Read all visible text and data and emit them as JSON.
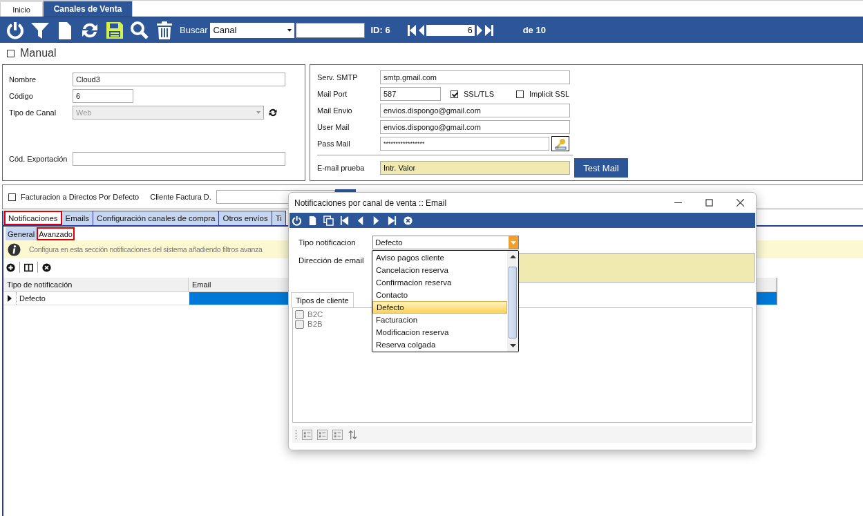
{
  "app_tabs": [
    {
      "label": "Inicio",
      "selected": false
    },
    {
      "label": "Canales de Venta",
      "selected": true
    }
  ],
  "toolbar": {
    "search_label": "Buscar",
    "search_by": "Canal",
    "id_label": "ID: 6",
    "record": "6",
    "record_total": "de 10"
  },
  "manual": {
    "label": "Manual",
    "checked": false
  },
  "general_fields": [
    {
      "kind": "text",
      "label": "Nombre",
      "value": "Cloud3"
    },
    {
      "kind": "short",
      "label": "Código",
      "value": "6"
    },
    {
      "kind": "select",
      "label": "Tipo de Canal",
      "value": "Web",
      "disabled": true
    },
    {
      "kind": "text",
      "label": "Cód. Exportación"
    }
  ],
  "mail_fields": [
    {
      "kind": "text",
      "label": "Serv. SMTP",
      "value": "smtp.gmail.com"
    },
    {
      "kind": "port",
      "label": "Mail Port",
      "value": "587",
      "options": [
        {
          "label": "SSL/TLS",
          "checked": true
        },
        {
          "label": "Implicit SSL",
          "checked": false
        }
      ]
    },
    {
      "kind": "text",
      "label": "Mail Envio",
      "value": "envios.dispongo@gmail.com"
    },
    {
      "kind": "text",
      "label": "User Mail",
      "value": "envios.dispongo@gmail.com"
    },
    {
      "kind": "password",
      "label": "Pass Mail",
      "value": "*****************"
    },
    {
      "kind": "test",
      "label": "E-mail prueba",
      "value": "Intr. Valor",
      "button": "Test Mail"
    }
  ],
  "billing": {
    "label": "Facturacion a Directos Por Defecto",
    "checked": false,
    "client_label": "Cliente Factura D."
  },
  "section_tabs": [
    {
      "label": "Notificaciones",
      "selected": true,
      "highlighted": true
    },
    {
      "label": "Emails",
      "selected": false,
      "highlighted": false
    },
    {
      "label": "Configuración canales de compra",
      "selected": false,
      "highlighted": false
    },
    {
      "label": "Otros envíos",
      "selected": false,
      "highlighted": false
    },
    {
      "label": "Ti",
      "selected": false,
      "highlighted": false
    }
  ],
  "sub_tabs": [
    {
      "label": "General",
      "selected": false,
      "highlighted": false
    },
    {
      "label": "Avanzado",
      "selected": true,
      "highlighted": true
    }
  ],
  "info": "Configura en esta sección notificaciones del sistema añadiendo filtros avanza",
  "grid": {
    "columns": [
      "Tipo de notificación",
      "Email"
    ],
    "rows": [
      {
        "type": "Defecto",
        "selected": true
      }
    ]
  },
  "dialog": {
    "title": "Notificaciones por canal de venta :: Email",
    "type_label": "Tipo notificacion",
    "type_value": "Defecto",
    "email_label": "Dirección de email",
    "options": [
      {
        "label": "Aviso pagos cliente",
        "selected": false
      },
      {
        "label": "Cancelacion reserva",
        "selected": false
      },
      {
        "label": "Confirmacion reserva",
        "selected": false
      },
      {
        "label": "Contacto",
        "selected": false
      },
      {
        "label": "Defecto",
        "selected": true
      },
      {
        "label": "Facturacion",
        "selected": false
      },
      {
        "label": "Modificacion reserva",
        "selected": false
      },
      {
        "label": "Reserva colgada",
        "selected": false
      }
    ],
    "client_tab": "Tipos de cliente",
    "clients": [
      {
        "label": "B2C",
        "checked": false
      },
      {
        "label": "B2B",
        "checked": false
      }
    ]
  }
}
